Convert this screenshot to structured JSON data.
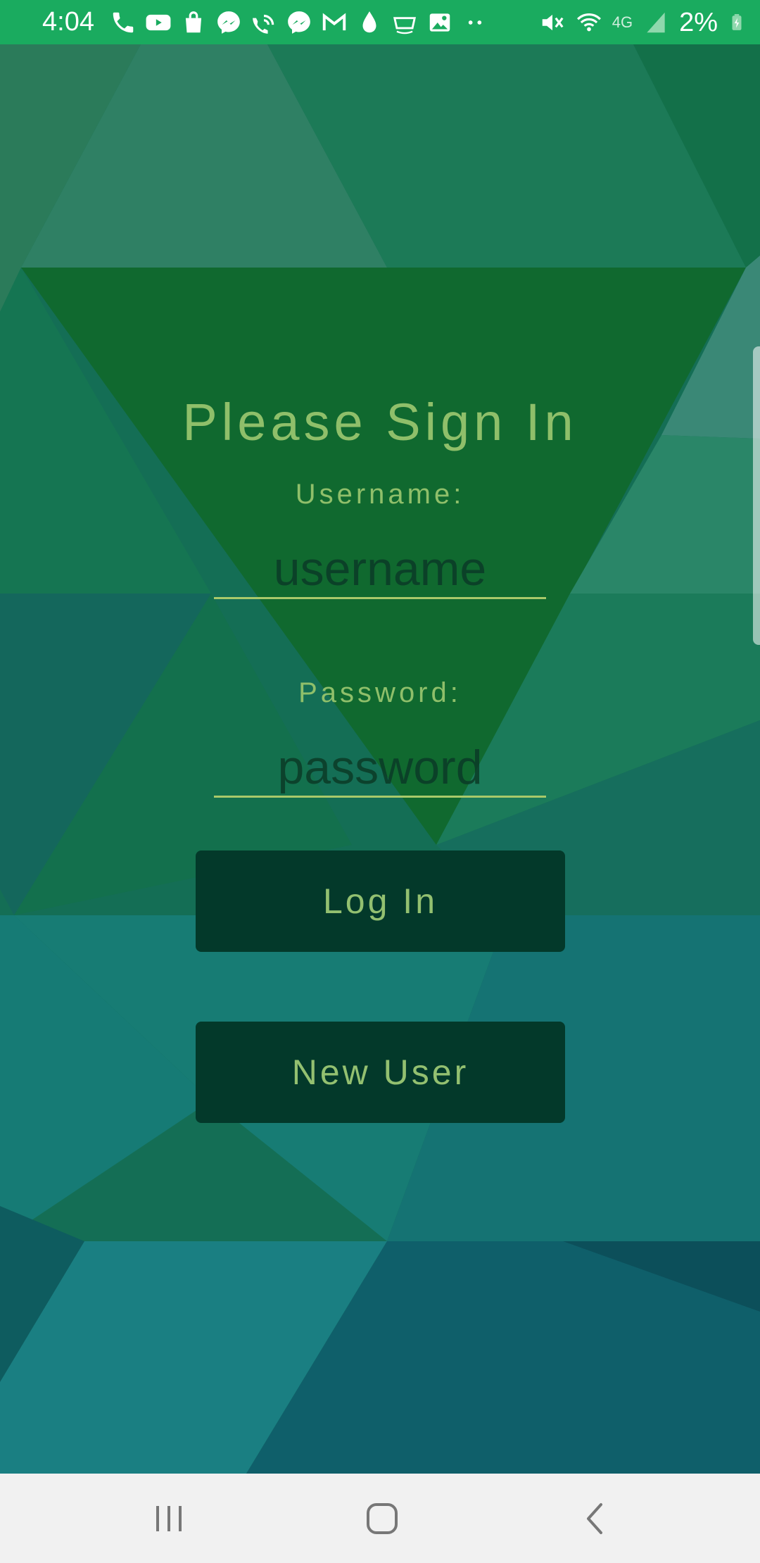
{
  "status_bar": {
    "time": "4:04",
    "battery_percent": "2%",
    "network_label": "4G",
    "notification_icons": [
      "phone-icon",
      "youtube-icon",
      "shopping-bag-icon",
      "messenger-icon",
      "wifi-call-icon",
      "messenger-icon",
      "gmail-icon",
      "water-drop-icon",
      "amazon-icon",
      "gallery-icon",
      "more-dots-icon"
    ],
    "system_icons": [
      "mute-icon",
      "wifi-icon",
      "signal-icon",
      "battery-charging-icon"
    ]
  },
  "login": {
    "title": "Please Sign In",
    "username_label": "Username:",
    "username_placeholder": "username",
    "password_label": "Password:",
    "password_placeholder": "password",
    "login_button": "Log In",
    "new_user_button": "New User"
  },
  "nav_bar": {
    "recent_icon": "recent-apps-icon",
    "home_icon": "home-icon",
    "back_icon": "back-icon"
  },
  "colors": {
    "status_bar": "#1aab5f",
    "accent_text": "#8fbf6a",
    "button_bg": "#03392a",
    "nav_bar": "#f1f1f1"
  }
}
